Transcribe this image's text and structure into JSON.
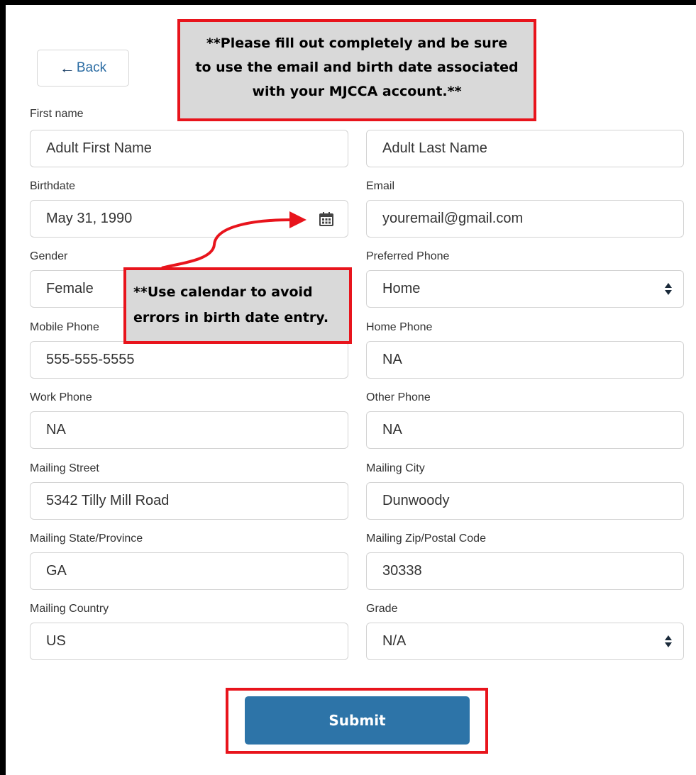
{
  "back_label": "Back",
  "notes": {
    "top_lines": [
      "**Please fill out completely and be sure",
      "to use the email and birth date associated",
      "with your MJCCA account.**"
    ],
    "calendar_lines": [
      "**Use calendar to avoid",
      "errors in birth date entry."
    ]
  },
  "form": {
    "first_name": {
      "label": "First name",
      "value": "Adult First Name"
    },
    "last_name": {
      "value": "Adult Last Name"
    },
    "birthdate": {
      "label": "Birthdate",
      "value": "May 31, 1990",
      "icon": "calendar-icon"
    },
    "email": {
      "label": "Email",
      "value": "youremail@gmail.com"
    },
    "gender": {
      "label": "Gender",
      "value": "Female"
    },
    "preferred_phone": {
      "label": "Preferred Phone",
      "value": "Home"
    },
    "mobile_phone": {
      "label": "Mobile Phone",
      "value": "555-555-5555"
    },
    "home_phone": {
      "label": "Home Phone",
      "value": "NA"
    },
    "work_phone": {
      "label": "Work Phone",
      "value": "NA"
    },
    "other_phone": {
      "label": "Other Phone",
      "value": "NA"
    },
    "mailing_street": {
      "label": "Mailing Street",
      "value": "5342 Tilly Mill Road"
    },
    "mailing_city": {
      "label": "Mailing City",
      "value": "Dunwoody"
    },
    "mailing_state": {
      "label": "Mailing State/Province",
      "value": "GA"
    },
    "mailing_zip": {
      "label": "Mailing Zip/Postal Code",
      "value": "30338"
    },
    "mailing_country": {
      "label": "Mailing Country",
      "value": "US"
    },
    "grade": {
      "label": "Grade",
      "value": "N/A"
    }
  },
  "submit_label": "Submit",
  "colors": {
    "accent": "#2d74a8",
    "highlight": "#e8141c",
    "callout_bg": "#d9d9d9"
  }
}
